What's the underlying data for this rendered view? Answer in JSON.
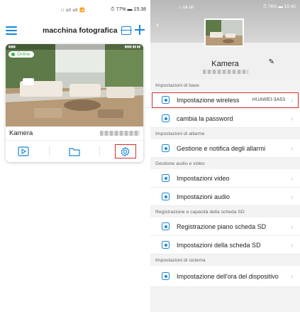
{
  "left": {
    "status": {
      "signal": "⁝⁝ ull ull 📶",
      "time": "15:38",
      "battery": "77%"
    },
    "header": {
      "title": "macchina fotografica"
    },
    "card": {
      "online": "Online",
      "camera_name": "Kamera"
    }
  },
  "right": {
    "status": {
      "signal": "⁝⁝ ull ull",
      "battery": "76%",
      "time": "15:42"
    },
    "camera_name": "Kamera",
    "sections": [
      {
        "header": "Impostazioni di base",
        "rows": [
          {
            "label": "Impostazione wireless",
            "value": "HUAWEI-3A63",
            "icon": "wifi-icon"
          },
          {
            "label": "cambia la password",
            "value": "",
            "icon": "lock-icon"
          }
        ]
      },
      {
        "header": "Impostazioni di allarme",
        "rows": [
          {
            "label": "Gestione e notifica degli allarmi",
            "value": "",
            "icon": "alarm-icon"
          }
        ]
      },
      {
        "header": "Gestione audio e video",
        "rows": [
          {
            "label": "Impostazioni video",
            "value": "",
            "icon": "camera-icon"
          },
          {
            "label": "Impostazioni audio",
            "value": "",
            "icon": "speaker-icon"
          }
        ]
      },
      {
        "header": "Registrazione e capacità della scheda SD",
        "rows": [
          {
            "label": "Registrazione piano scheda SD",
            "value": "",
            "icon": "record-icon"
          },
          {
            "label": "Impostazioni della scheda SD",
            "value": "",
            "icon": "sd-card-icon"
          }
        ]
      },
      {
        "header": "Impostazioni di sistema",
        "rows": [
          {
            "label": "Impostazione dell'ora del dispositivo",
            "value": "",
            "icon": "clock-icon"
          }
        ]
      }
    ]
  },
  "colors": {
    "accent": "#1a86d6",
    "highlight": "#d32f2f",
    "online": "#3cb34a"
  }
}
